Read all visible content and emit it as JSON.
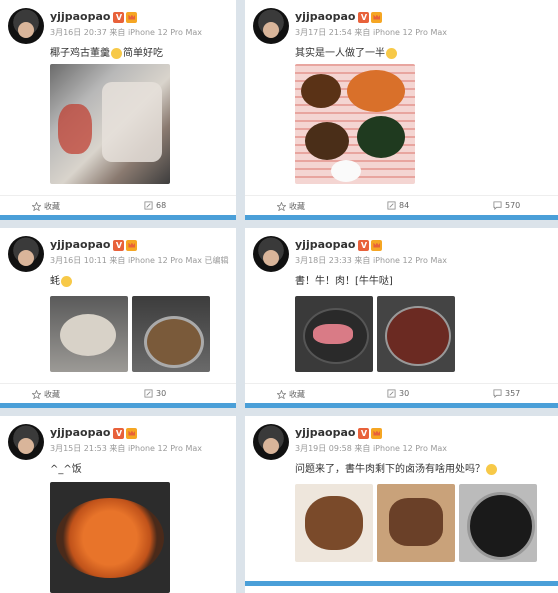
{
  "posts": [
    {
      "user": "yjjpaopao",
      "meta": "3月16日 20:37 来自 iPhone 12 Pro Max",
      "text_a": "椰子鸡古董羹",
      "text_b": "简单好吃",
      "collect": "收藏",
      "repost": "68",
      "comment": ""
    },
    {
      "user": "yjjpaopao",
      "meta": "3月17日 21:54 来自 iPhone 12 Pro Max",
      "text_a": "其实是一人做了一半",
      "text_b": "",
      "collect": "收藏",
      "repost": "84",
      "comment": "570"
    },
    {
      "user": "yjjpaopao",
      "meta": "3月16日 10:11 来自 iPhone 12 Pro Max  已编辑",
      "text_a": "蚝",
      "text_b": "",
      "collect": "收藏",
      "repost": "30",
      "comment": ""
    },
    {
      "user": "yjjpaopao",
      "meta": "3月18日 23:33 来自 iPhone 12 Pro Max",
      "text_a": "書！牛！肉！[牛牛哒]",
      "text_b": "",
      "collect": "收藏",
      "repost": "30",
      "comment": "357"
    },
    {
      "user": "yjjpaopao",
      "meta": "3月15日 21:53 来自 iPhone 12 Pro Max",
      "text_a": "^_^饭",
      "text_b": "",
      "collect": "",
      "repost": "",
      "comment": ""
    },
    {
      "user": "yjjpaopao",
      "meta": "3月19日 09:58 来自 iPhone 12 Pro Max",
      "text_a": "问题来了，書牛肉剩下的卤汤有啥用处吗？",
      "text_b": "",
      "collect": "",
      "repost": "",
      "comment": ""
    }
  ]
}
